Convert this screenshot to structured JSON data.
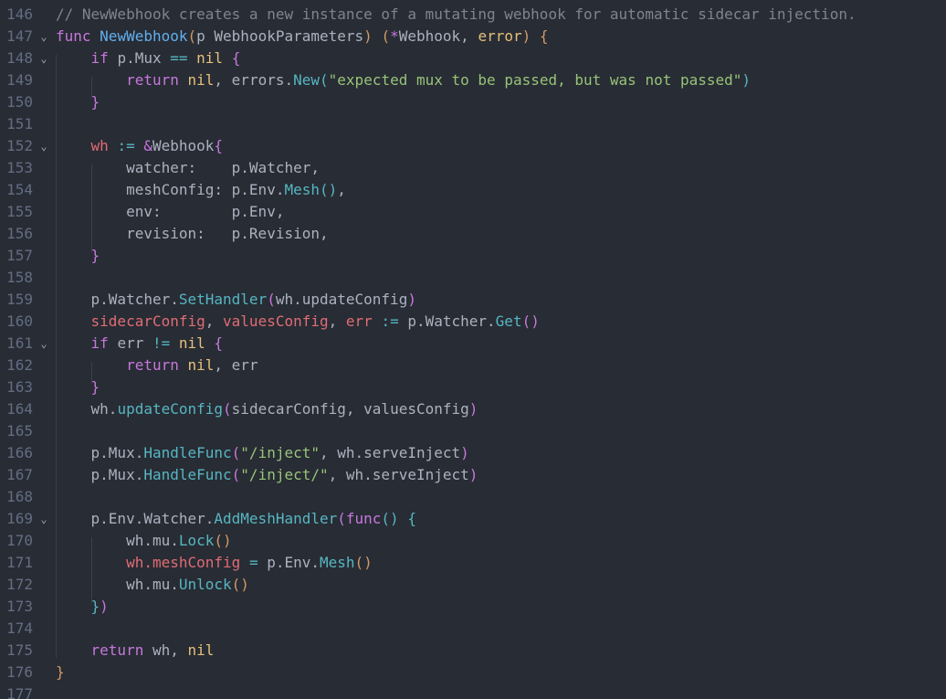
{
  "editor": {
    "lines": [
      {
        "num": "146",
        "fold": false,
        "tokens": [
          [
            "// NewWebhook creates a new instance of a mutating webhook for automatic sidecar injection.",
            "com"
          ]
        ]
      },
      {
        "num": "147",
        "fold": true,
        "tokens": [
          [
            "func ",
            "kw"
          ],
          [
            "NewWebhook",
            "fn"
          ],
          [
            "(",
            "brk1"
          ],
          [
            "p WebhookParameters",
            "plain"
          ],
          [
            ")",
            "brk1"
          ],
          [
            " ",
            "plain"
          ],
          [
            "(",
            "brk1"
          ],
          [
            "*",
            "kw"
          ],
          [
            "Webhook, ",
            "plain"
          ],
          [
            "error",
            "type"
          ],
          [
            ")",
            "brk1"
          ],
          [
            " ",
            "plain"
          ],
          [
            "{",
            "brk1"
          ]
        ]
      },
      {
        "num": "148",
        "fold": true,
        "tokens": [
          [
            "    ",
            "plain"
          ],
          [
            "if ",
            "kw"
          ],
          [
            "p.Mux ",
            "plain"
          ],
          [
            "==",
            "op"
          ],
          [
            " ",
            "plain"
          ],
          [
            "nil",
            "type"
          ],
          [
            " ",
            "plain"
          ],
          [
            "{",
            "brk2"
          ]
        ]
      },
      {
        "num": "149",
        "fold": false,
        "tokens": [
          [
            "        ",
            "plain"
          ],
          [
            "return ",
            "kw"
          ],
          [
            "nil",
            "type"
          ],
          [
            ", errors.",
            "plain"
          ],
          [
            "New",
            "meth"
          ],
          [
            "(",
            "brk3"
          ],
          [
            "\"expected mux to be passed, but was not passed\"",
            "str"
          ],
          [
            ")",
            "brk3"
          ]
        ]
      },
      {
        "num": "150",
        "fold": false,
        "tokens": [
          [
            "    ",
            "plain"
          ],
          [
            "}",
            "brk2"
          ]
        ]
      },
      {
        "num": "151",
        "fold": false,
        "tokens": []
      },
      {
        "num": "152",
        "fold": true,
        "tokens": [
          [
            "    ",
            "plain"
          ],
          [
            "wh",
            "var"
          ],
          [
            " ",
            "plain"
          ],
          [
            ":=",
            "op"
          ],
          [
            " ",
            "plain"
          ],
          [
            "&",
            "kw"
          ],
          [
            "Webhook",
            "plain"
          ],
          [
            "{",
            "brk2"
          ]
        ]
      },
      {
        "num": "153",
        "fold": false,
        "tokens": [
          [
            "        watcher:    p.Watcher,",
            "plain"
          ]
        ]
      },
      {
        "num": "154",
        "fold": false,
        "tokens": [
          [
            "        meshConfig: p.Env.",
            "plain"
          ],
          [
            "Mesh",
            "meth"
          ],
          [
            "()",
            "brk3"
          ],
          [
            ",",
            "plain"
          ]
        ]
      },
      {
        "num": "155",
        "fold": false,
        "tokens": [
          [
            "        env:        p.Env,",
            "plain"
          ]
        ]
      },
      {
        "num": "156",
        "fold": false,
        "tokens": [
          [
            "        revision:   p.Revision,",
            "plain"
          ]
        ]
      },
      {
        "num": "157",
        "fold": false,
        "tokens": [
          [
            "    ",
            "plain"
          ],
          [
            "}",
            "brk2"
          ]
        ]
      },
      {
        "num": "158",
        "fold": false,
        "tokens": []
      },
      {
        "num": "159",
        "fold": false,
        "tokens": [
          [
            "    p.Watcher.",
            "plain"
          ],
          [
            "SetHandler",
            "meth"
          ],
          [
            "(",
            "brk2"
          ],
          [
            "wh.updateConfig",
            "plain"
          ],
          [
            ")",
            "brk2"
          ]
        ]
      },
      {
        "num": "160",
        "fold": false,
        "tokens": [
          [
            "    ",
            "plain"
          ],
          [
            "sidecarConfig",
            "var"
          ],
          [
            ", ",
            "plain"
          ],
          [
            "valuesConfig",
            "var"
          ],
          [
            ", ",
            "plain"
          ],
          [
            "err",
            "var"
          ],
          [
            " ",
            "plain"
          ],
          [
            ":=",
            "op"
          ],
          [
            " p.Watcher.",
            "plain"
          ],
          [
            "Get",
            "meth"
          ],
          [
            "()",
            "brk2"
          ]
        ]
      },
      {
        "num": "161",
        "fold": true,
        "tokens": [
          [
            "    ",
            "plain"
          ],
          [
            "if ",
            "kw"
          ],
          [
            "err ",
            "plain"
          ],
          [
            "!=",
            "op"
          ],
          [
            " ",
            "plain"
          ],
          [
            "nil",
            "type"
          ],
          [
            " ",
            "plain"
          ],
          [
            "{",
            "brk2"
          ]
        ]
      },
      {
        "num": "162",
        "fold": false,
        "tokens": [
          [
            "        ",
            "plain"
          ],
          [
            "return ",
            "kw"
          ],
          [
            "nil",
            "type"
          ],
          [
            ", err",
            "plain"
          ]
        ]
      },
      {
        "num": "163",
        "fold": false,
        "tokens": [
          [
            "    ",
            "plain"
          ],
          [
            "}",
            "brk2"
          ]
        ]
      },
      {
        "num": "164",
        "fold": false,
        "tokens": [
          [
            "    wh.",
            "plain"
          ],
          [
            "updateConfig",
            "meth"
          ],
          [
            "(",
            "brk2"
          ],
          [
            "sidecarConfig, valuesConfig",
            "plain"
          ],
          [
            ")",
            "brk2"
          ]
        ]
      },
      {
        "num": "165",
        "fold": false,
        "tokens": []
      },
      {
        "num": "166",
        "fold": false,
        "tokens": [
          [
            "    p.Mux.",
            "plain"
          ],
          [
            "HandleFunc",
            "meth"
          ],
          [
            "(",
            "brk2"
          ],
          [
            "\"/inject\"",
            "str"
          ],
          [
            ", wh.serveInject",
            "plain"
          ],
          [
            ")",
            "brk2"
          ]
        ]
      },
      {
        "num": "167",
        "fold": false,
        "tokens": [
          [
            "    p.Mux.",
            "plain"
          ],
          [
            "HandleFunc",
            "meth"
          ],
          [
            "(",
            "brk2"
          ],
          [
            "\"/inject/\"",
            "str"
          ],
          [
            ", wh.serveInject",
            "plain"
          ],
          [
            ")",
            "brk2"
          ]
        ]
      },
      {
        "num": "168",
        "fold": false,
        "tokens": []
      },
      {
        "num": "169",
        "fold": true,
        "tokens": [
          [
            "    p.Env.Watcher.",
            "plain"
          ],
          [
            "AddMeshHandler",
            "meth"
          ],
          [
            "(",
            "brk2"
          ],
          [
            "func",
            "kw"
          ],
          [
            "()",
            "brk3"
          ],
          [
            " ",
            "plain"
          ],
          [
            "{",
            "brk3"
          ]
        ]
      },
      {
        "num": "170",
        "fold": false,
        "tokens": [
          [
            "        wh.mu.",
            "plain"
          ],
          [
            "Lock",
            "meth"
          ],
          [
            "()",
            "brk1"
          ]
        ]
      },
      {
        "num": "171",
        "fold": false,
        "tokens": [
          [
            "        ",
            "plain"
          ],
          [
            "wh.meshConfig",
            "var"
          ],
          [
            " ",
            "plain"
          ],
          [
            "=",
            "op"
          ],
          [
            " p.Env.",
            "plain"
          ],
          [
            "Mesh",
            "meth"
          ],
          [
            "()",
            "brk1"
          ]
        ]
      },
      {
        "num": "172",
        "fold": false,
        "tokens": [
          [
            "        wh.mu.",
            "plain"
          ],
          [
            "Unlock",
            "meth"
          ],
          [
            "()",
            "brk1"
          ]
        ]
      },
      {
        "num": "173",
        "fold": false,
        "tokens": [
          [
            "    ",
            "plain"
          ],
          [
            "}",
            "brk3"
          ],
          [
            ")",
            "brk2"
          ]
        ]
      },
      {
        "num": "174",
        "fold": false,
        "tokens": []
      },
      {
        "num": "175",
        "fold": false,
        "tokens": [
          [
            "    ",
            "plain"
          ],
          [
            "return ",
            "kw"
          ],
          [
            "wh, ",
            "plain"
          ],
          [
            "nil",
            "type"
          ]
        ]
      },
      {
        "num": "176",
        "fold": false,
        "tokens": [
          [
            "}",
            "brk1"
          ]
        ]
      },
      {
        "num": "177",
        "fold": false,
        "tokens": []
      }
    ]
  }
}
